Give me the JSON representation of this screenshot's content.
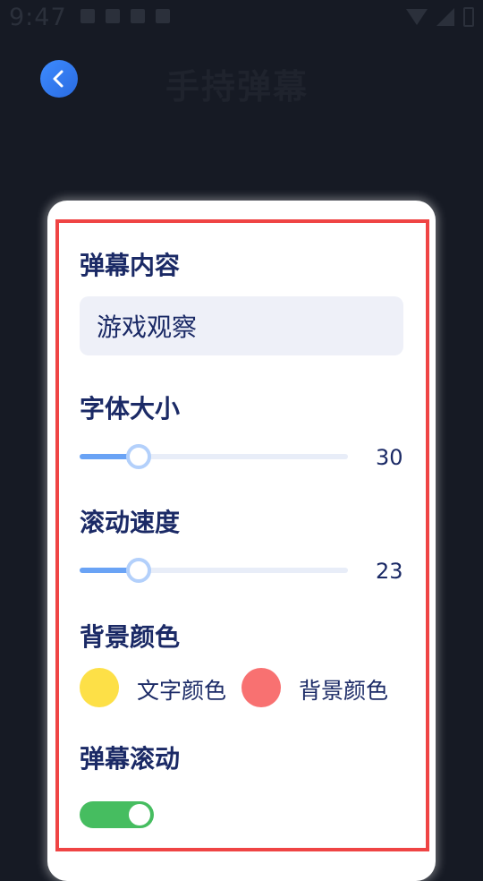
{
  "status_bar": {
    "time": "9:47"
  },
  "header": {
    "title": "手持弹幕"
  },
  "form": {
    "content_label": "弹幕内容",
    "content_value": "游戏观察",
    "font_size_label": "字体大小",
    "font_size_value": "30",
    "font_size_fraction": 0.22,
    "speed_label": "滚动速度",
    "speed_value": "23",
    "speed_fraction": 0.22,
    "bg_color_label": "背景颜色",
    "text_color_option": "文字颜色",
    "text_color_hex": "#fde047",
    "bg_color_option": "背景颜色",
    "bg_color_hex": "#f87171",
    "scroll_label": "弹幕滚动",
    "scroll_enabled": true
  },
  "colors": {
    "accent": "#2f7bf5",
    "highlight": "#ef4444",
    "toggle_on": "#46bd60"
  }
}
